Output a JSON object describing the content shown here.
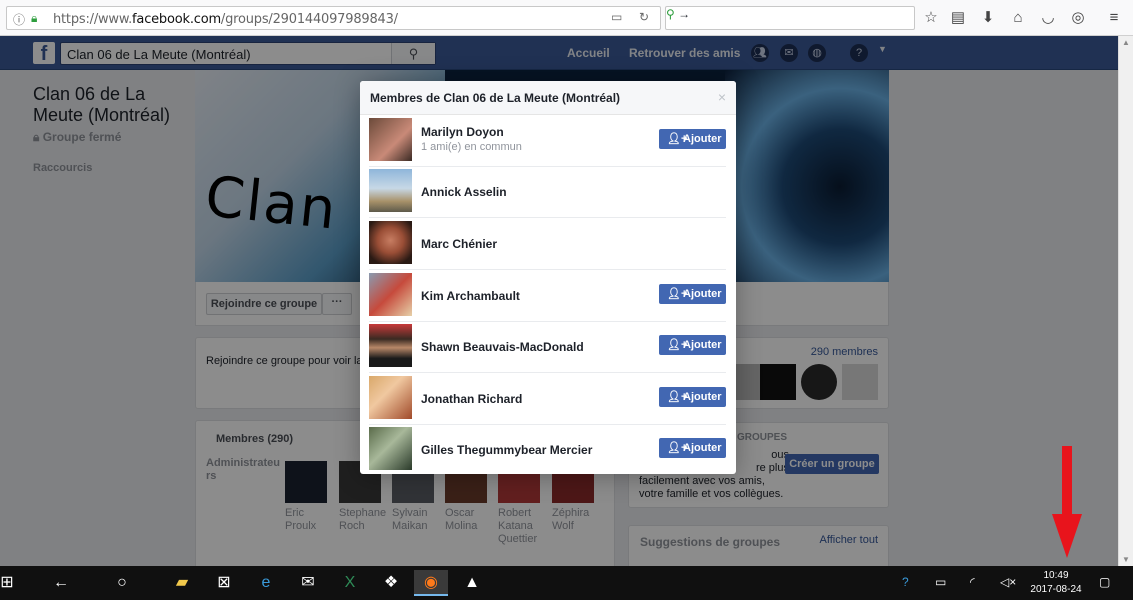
{
  "browser": {
    "url_prefix": "https://www.",
    "url_domain": "facebook.com",
    "url_path": "/groups/290144097989843/"
  },
  "fb_header": {
    "logo": "f",
    "search_value": "Clan 06 de La Meute (Montréal)",
    "nav_home": "Accueil",
    "nav_find_friends": "Retrouver des amis"
  },
  "group": {
    "name": "Clan 06 de La Meute (Montréal)",
    "type": "Groupe fermé",
    "shortcuts_label": "Raccourcis",
    "cover_text": "Clan 0",
    "join_button": "Rejoindre ce groupe",
    "more_button": "···",
    "join_info": "Rejoindre ce groupe pour voir la c",
    "members_title": "Membres (290)",
    "admins_label": "Administrateurs",
    "admins": [
      {
        "first": "Eric",
        "last": "Proulx"
      },
      {
        "first": "Stephane",
        "last": "Roch"
      },
      {
        "first": "Sylvain",
        "last": "Maikan"
      },
      {
        "first": "Oscar",
        "last": "Molina"
      },
      {
        "first": "Robert",
        "last": "Katana Quettier"
      },
      {
        "first": "Zéphira",
        "last": "Wolf"
      }
    ],
    "members_count_link": "290 membres",
    "groups_heading": "GROUPES",
    "create_text_1": "ous",
    "create_text_2": "re plus",
    "create_text_3": "facilement avec vos amis,",
    "create_text_4": "votre famille et vos collègues.",
    "create_button": "Créer un groupe",
    "suggestions_title": "Suggestions de groupes",
    "suggestions_link": "Afficher tout"
  },
  "modal": {
    "title": "Membres de Clan 06 de La Meute (Montréal)",
    "close": "×",
    "add_label": "Ajouter",
    "members": [
      {
        "name": "Marilyn Doyon",
        "sub": "1 ami(e) en commun",
        "has_add": true
      },
      {
        "name": "Annick Asselin",
        "sub": "",
        "has_add": false
      },
      {
        "name": "Marc Chénier",
        "sub": "",
        "has_add": false
      },
      {
        "name": "Kim Archambault",
        "sub": "",
        "has_add": true
      },
      {
        "name": "Shawn Beauvais-MacDonald",
        "sub": "",
        "has_add": true
      },
      {
        "name": "Jonathan Richard",
        "sub": "",
        "has_add": true
      },
      {
        "name": "Gilles Thegummybear Mercier",
        "sub": "",
        "has_add": true
      }
    ]
  },
  "taskbar": {
    "time": "10:49",
    "date": "2017-08-24"
  },
  "colors": {
    "fb_blue": "#3b5998",
    "button_blue": "#4267b2",
    "arrow_red": "#e8141c"
  },
  "icons": [
    "info-icon",
    "lock-icon",
    "reader-icon",
    "reload-icon",
    "bookmark-star-icon",
    "downloads-icon",
    "home-icon",
    "pocket-icon",
    "menu-icon",
    "search-icon",
    "friends-icon",
    "messages-icon",
    "globe-icon",
    "help-icon",
    "add-friend-icon",
    "windows-start-icon",
    "back-icon",
    "cortana-icon"
  ]
}
